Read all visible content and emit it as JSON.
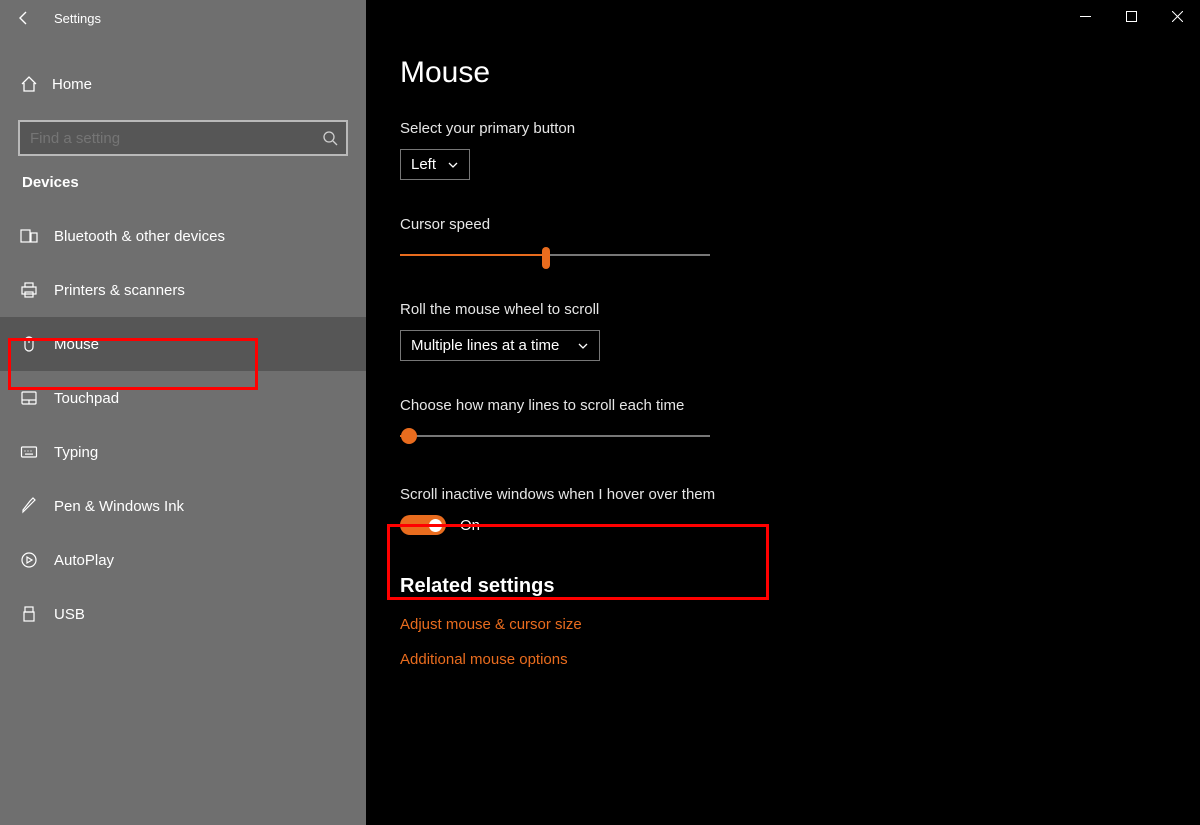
{
  "window": {
    "title": "Settings"
  },
  "sidebar": {
    "home": "Home",
    "search_placeholder": "Find a setting",
    "section": "Devices",
    "items": [
      {
        "label": "Bluetooth & other devices"
      },
      {
        "label": "Printers & scanners"
      },
      {
        "label": "Mouse"
      },
      {
        "label": "Touchpad"
      },
      {
        "label": "Typing"
      },
      {
        "label": "Pen & Windows Ink"
      },
      {
        "label": "AutoPlay"
      },
      {
        "label": "USB"
      }
    ]
  },
  "main": {
    "title": "Mouse",
    "primary_button_label": "Select your primary button",
    "primary_button_value": "Left",
    "cursor_speed_label": "Cursor speed",
    "cursor_speed_percent": 47,
    "scroll_label": "Roll the mouse wheel to scroll",
    "scroll_value": "Multiple lines at a time",
    "lines_label": "Choose how many lines to scroll each time",
    "lines_percent": 3,
    "inactive_label": "Scroll inactive windows when I hover over them",
    "inactive_value": "On",
    "related_title": "Related settings",
    "links": [
      "Adjust mouse & cursor size",
      "Additional mouse options"
    ]
  }
}
